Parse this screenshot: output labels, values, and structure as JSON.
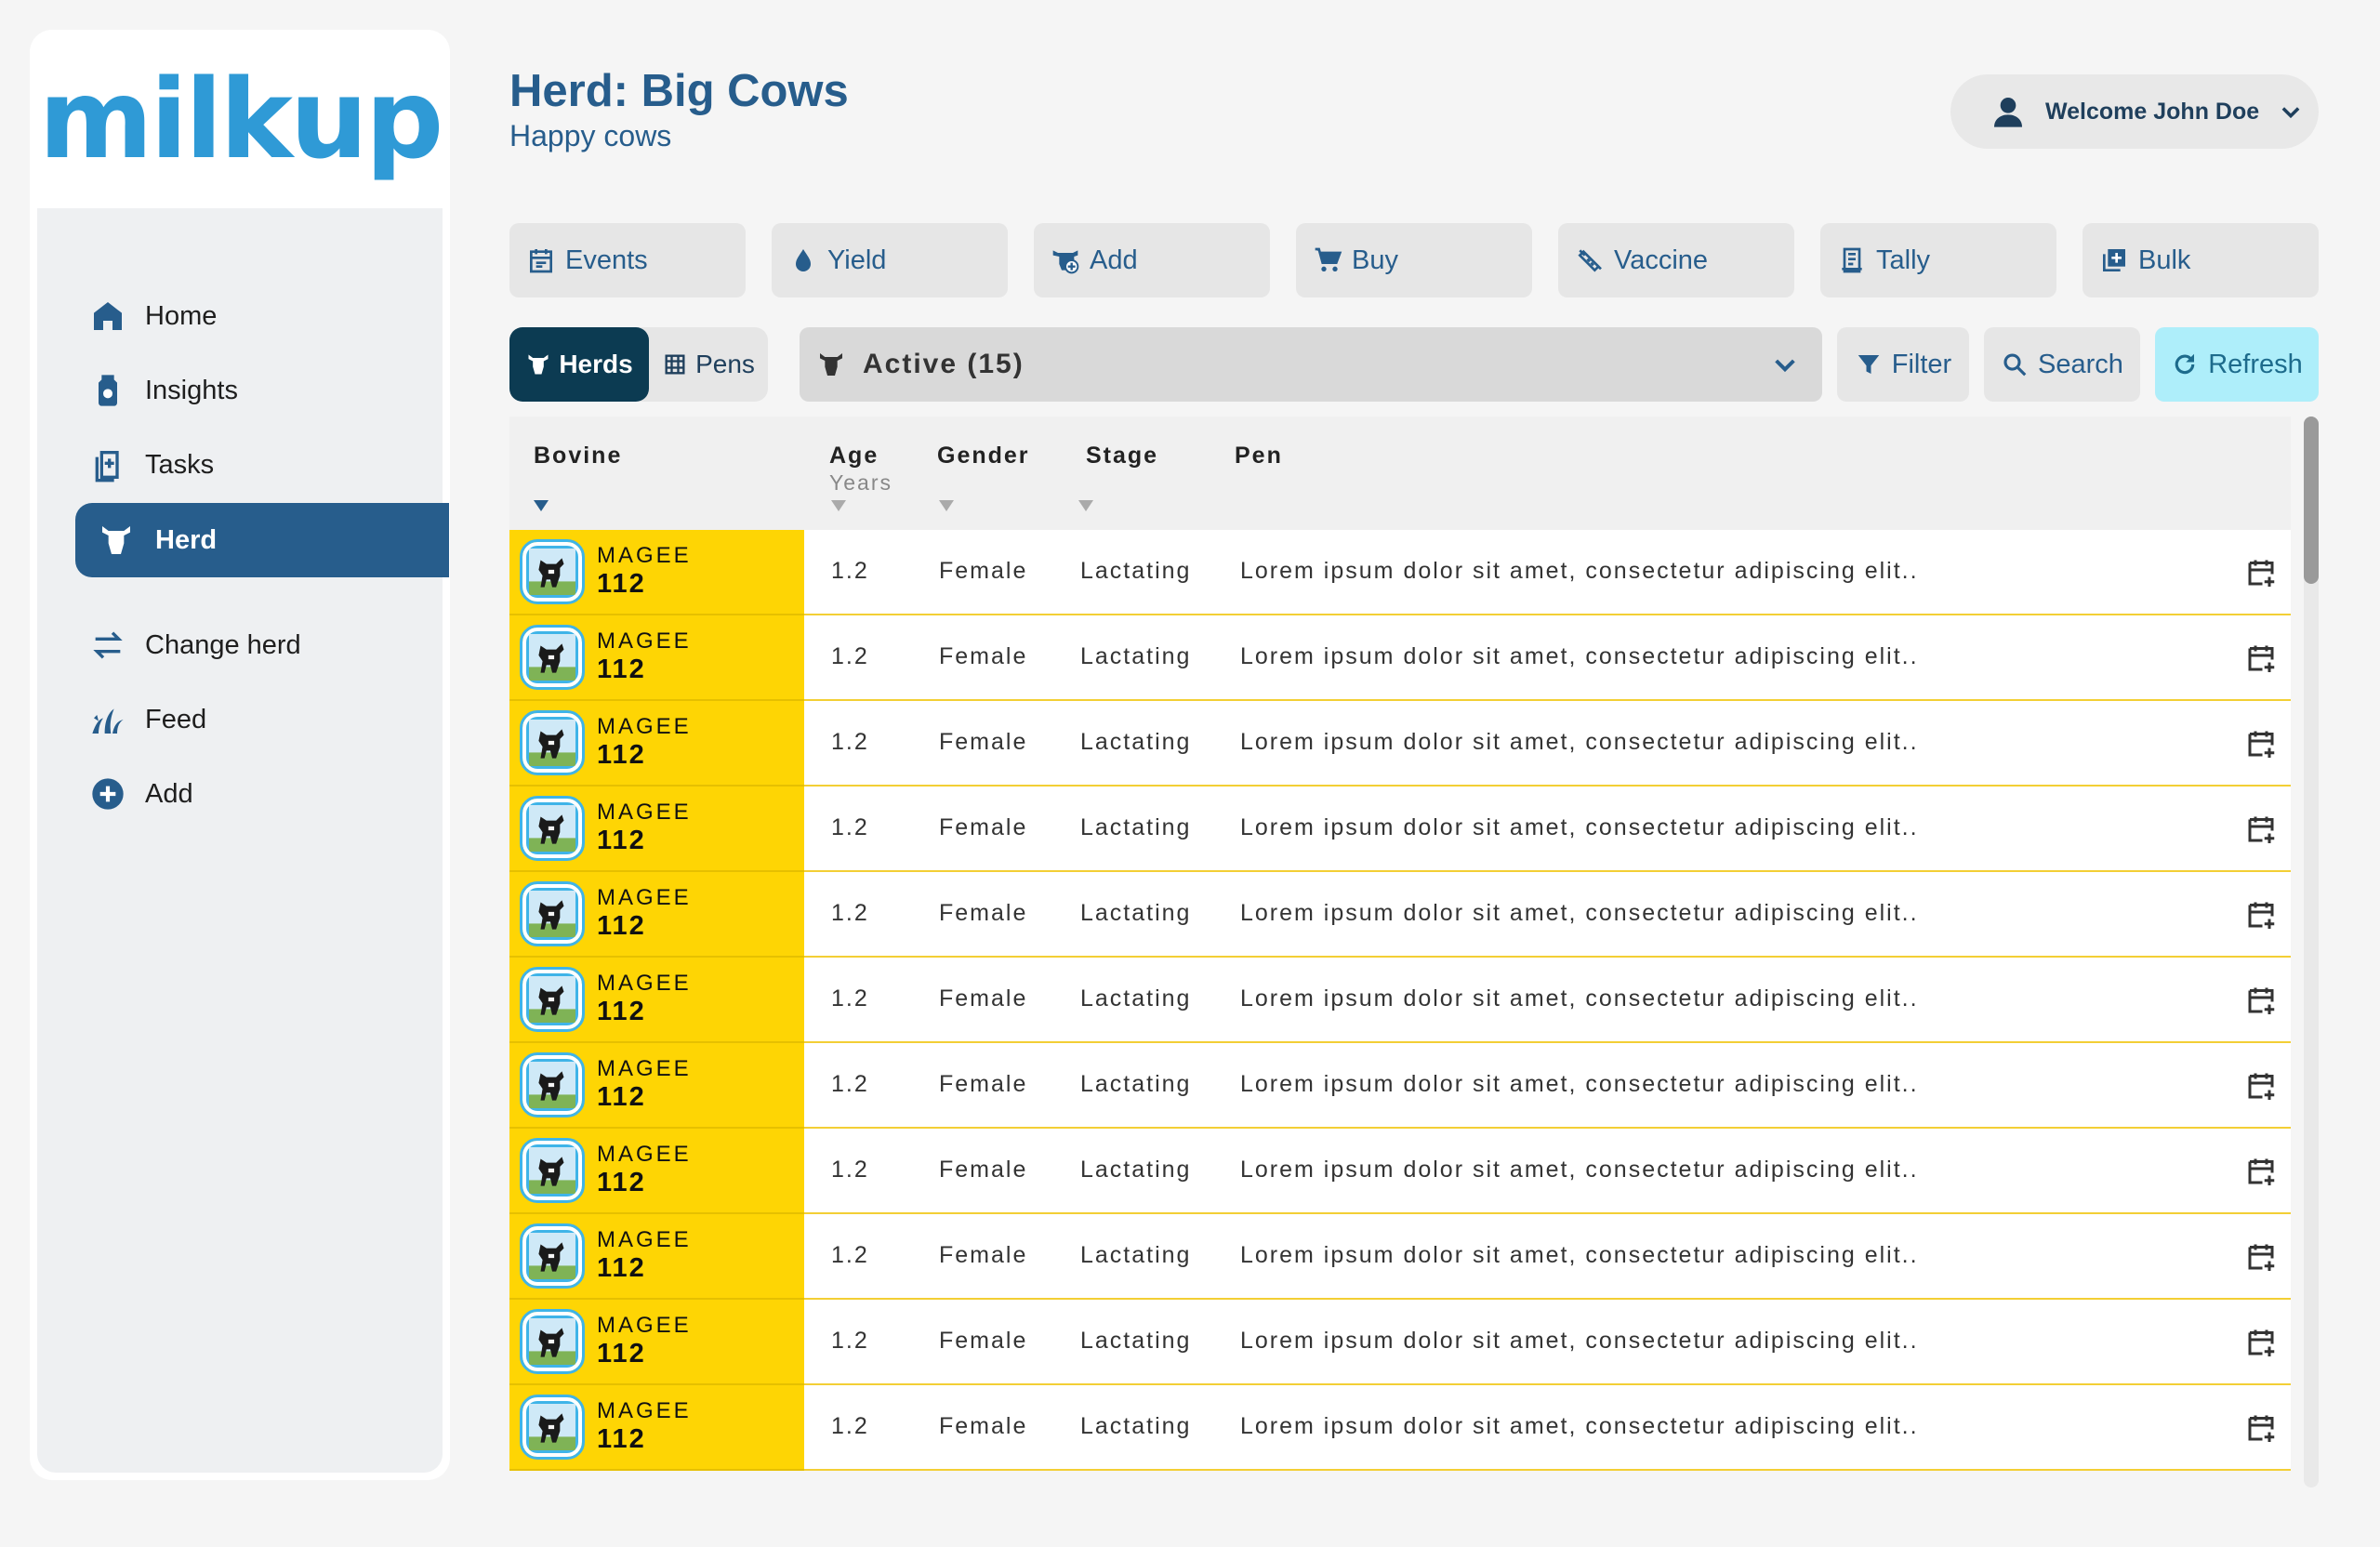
{
  "brand": {
    "logo_text": "milkup",
    "logo_color": "#2f9ad6"
  },
  "nav": {
    "items": [
      {
        "label": "Home",
        "icon": "home-icon"
      },
      {
        "label": "Insights",
        "icon": "insights-icon"
      },
      {
        "label": "Tasks",
        "icon": "tasks-icon"
      },
      {
        "label": "Herd",
        "icon": "herd-icon",
        "active": true
      },
      {
        "label": "Change herd",
        "icon": "swap-icon"
      },
      {
        "label": "Feed",
        "icon": "feed-icon"
      },
      {
        "label": "Add",
        "icon": "add-circle-icon"
      }
    ]
  },
  "header": {
    "title": "Herd: Big Cows",
    "subtitle": "Happy cows",
    "user_label": "Welcome John Doe"
  },
  "actions": [
    {
      "label": "Events",
      "icon": "calendar-icon"
    },
    {
      "label": "Yield",
      "icon": "drop-icon"
    },
    {
      "label": "Add",
      "icon": "add-cow-icon"
    },
    {
      "label": "Buy",
      "icon": "cart-icon"
    },
    {
      "label": "Vaccine",
      "icon": "syringe-icon"
    },
    {
      "label": "Tally",
      "icon": "tally-icon"
    },
    {
      "label": "Bulk",
      "icon": "bulk-icon"
    }
  ],
  "view_toggle": {
    "active": "Herds",
    "inactive": "Pens"
  },
  "filter_select": {
    "value": "Active (15)"
  },
  "tools": {
    "filter": "Filter",
    "search": "Search",
    "refresh": "Refresh"
  },
  "table": {
    "columns": {
      "bovine": "Bovine",
      "age": "Age",
      "age_unit": "Years",
      "gender": "Gender",
      "stage": "Stage",
      "pen": "Pen"
    },
    "rows": [
      {
        "name": "MAGEE",
        "number": "112",
        "age": "1.2",
        "gender": "Female",
        "stage": "Lactating",
        "pen": "Lorem ipsum dolor sit amet, consectetur adipiscing elit.."
      },
      {
        "name": "MAGEE",
        "number": "112",
        "age": "1.2",
        "gender": "Female",
        "stage": "Lactating",
        "pen": "Lorem ipsum dolor sit amet, consectetur adipiscing elit.."
      },
      {
        "name": "MAGEE",
        "number": "112",
        "age": "1.2",
        "gender": "Female",
        "stage": "Lactating",
        "pen": "Lorem ipsum dolor sit amet, consectetur adipiscing elit.."
      },
      {
        "name": "MAGEE",
        "number": "112",
        "age": "1.2",
        "gender": "Female",
        "stage": "Lactating",
        "pen": "Lorem ipsum dolor sit amet, consectetur adipiscing elit.."
      },
      {
        "name": "MAGEE",
        "number": "112",
        "age": "1.2",
        "gender": "Female",
        "stage": "Lactating",
        "pen": "Lorem ipsum dolor sit amet, consectetur adipiscing elit.."
      },
      {
        "name": "MAGEE",
        "number": "112",
        "age": "1.2",
        "gender": "Female",
        "stage": "Lactating",
        "pen": "Lorem ipsum dolor sit amet, consectetur adipiscing elit.."
      },
      {
        "name": "MAGEE",
        "number": "112",
        "age": "1.2",
        "gender": "Female",
        "stage": "Lactating",
        "pen": "Lorem ipsum dolor sit amet, consectetur adipiscing elit.."
      },
      {
        "name": "MAGEE",
        "number": "112",
        "age": "1.2",
        "gender": "Female",
        "stage": "Lactating",
        "pen": "Lorem ipsum dolor sit amet, consectetur adipiscing elit.."
      },
      {
        "name": "MAGEE",
        "number": "112",
        "age": "1.2",
        "gender": "Female",
        "stage": "Lactating",
        "pen": "Lorem ipsum dolor sit amet, consectetur adipiscing elit.."
      },
      {
        "name": "MAGEE",
        "number": "112",
        "age": "1.2",
        "gender": "Female",
        "stage": "Lactating",
        "pen": "Lorem ipsum dolor sit amet, consectetur adipiscing elit.."
      },
      {
        "name": "MAGEE",
        "number": "112",
        "age": "1.2",
        "gender": "Female",
        "stage": "Lactating",
        "pen": "Lorem ipsum dolor sit amet, consectetur adipiscing elit.."
      }
    ]
  },
  "colors": {
    "primary": "#275d8c",
    "highlight": "#fed504",
    "refresh_bg": "#aeeefa",
    "dark_toggle": "#0c3b52"
  }
}
